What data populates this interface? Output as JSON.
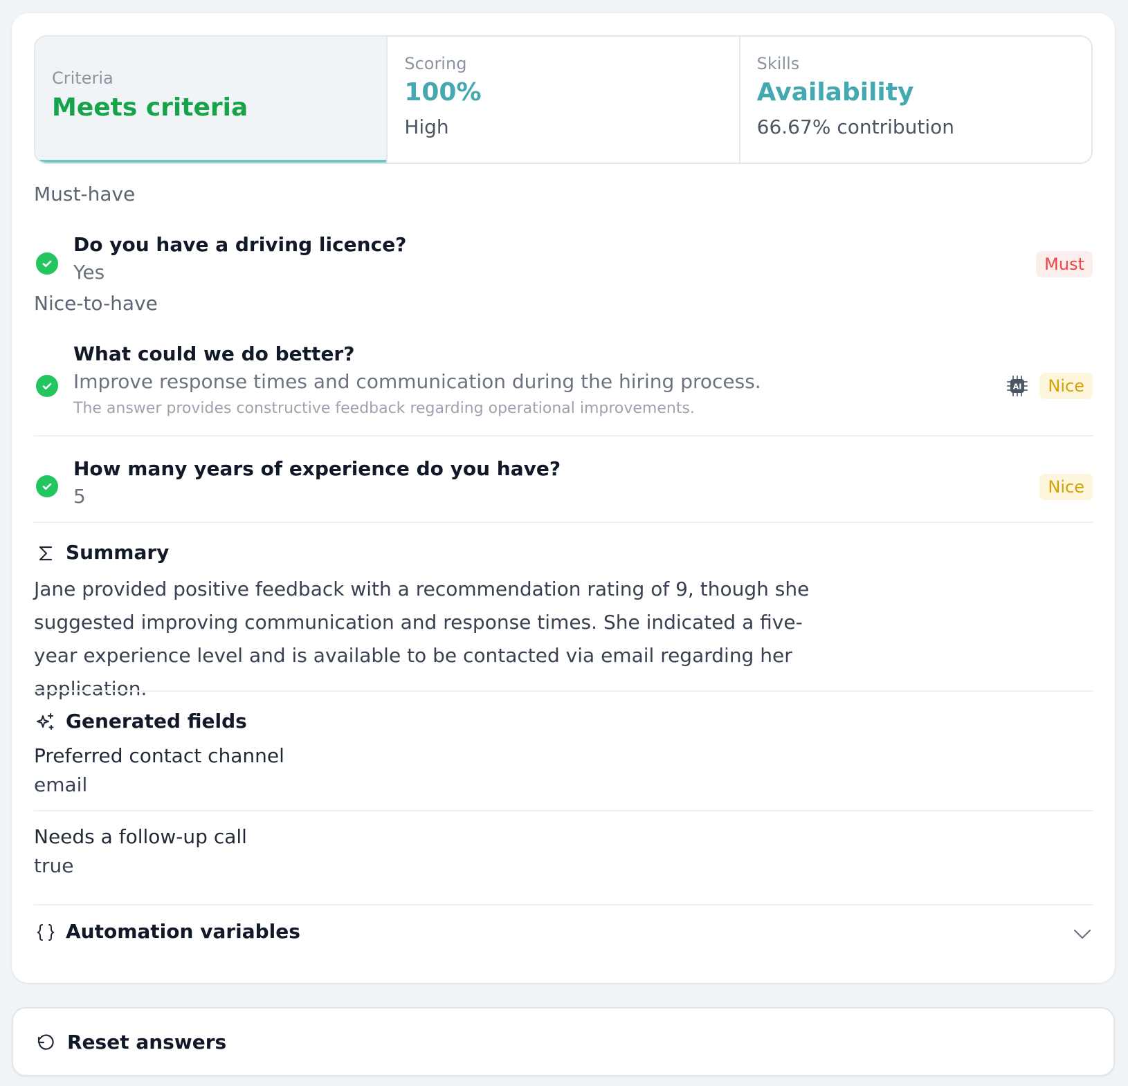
{
  "stats": [
    {
      "label": "Criteria",
      "value": "Meets criteria",
      "sub": "",
      "color": "#16a34a"
    },
    {
      "label": "Scoring",
      "value": "100%",
      "sub": "High",
      "color": "#44a8b0"
    },
    {
      "label": "Skills",
      "value": "Availability",
      "sub": "66.67% contribution",
      "color": "#44a8b0"
    }
  ],
  "must_have": {
    "title": "Must-have",
    "items": [
      {
        "question": "Do you have a driving licence?",
        "answer": "Yes",
        "badge": "Must"
      }
    ]
  },
  "nice_to_have": {
    "title": "Nice-to-have",
    "items": [
      {
        "question": "What could we do better?",
        "answer": "Improve response times and communication during the hiring process.",
        "reason": "The answer provides constructive feedback regarding operational improvements.",
        "badge": "Nice",
        "ai_icon": "ai-chip-icon"
      },
      {
        "question": "How many years of experience do you have?",
        "answer": "5",
        "badge": "Nice"
      }
    ]
  },
  "summary": {
    "title": "Summary",
    "icon": "sigma-icon",
    "text": "Jane provided positive feedback with a recommendation rating of 9, though she suggested improving communication and response times. She indicated a five-year experience level and is available to be contacted via email regarding her application."
  },
  "generated_fields": {
    "title": "Generated fields",
    "icon": "sparkles-icon",
    "fields": [
      {
        "label": "Preferred contact channel",
        "value": "email"
      },
      {
        "label": "Needs a follow-up call",
        "value": "true"
      }
    ]
  },
  "automation": {
    "title": "Automation variables",
    "icon": "braces-icon"
  },
  "reset": {
    "label": "Reset answers",
    "icon": "undo-icon"
  },
  "colors": {
    "accent": "#6cc4c6",
    "success": "#22c55e",
    "must": "#ef4444",
    "nice": "#d4a106"
  }
}
